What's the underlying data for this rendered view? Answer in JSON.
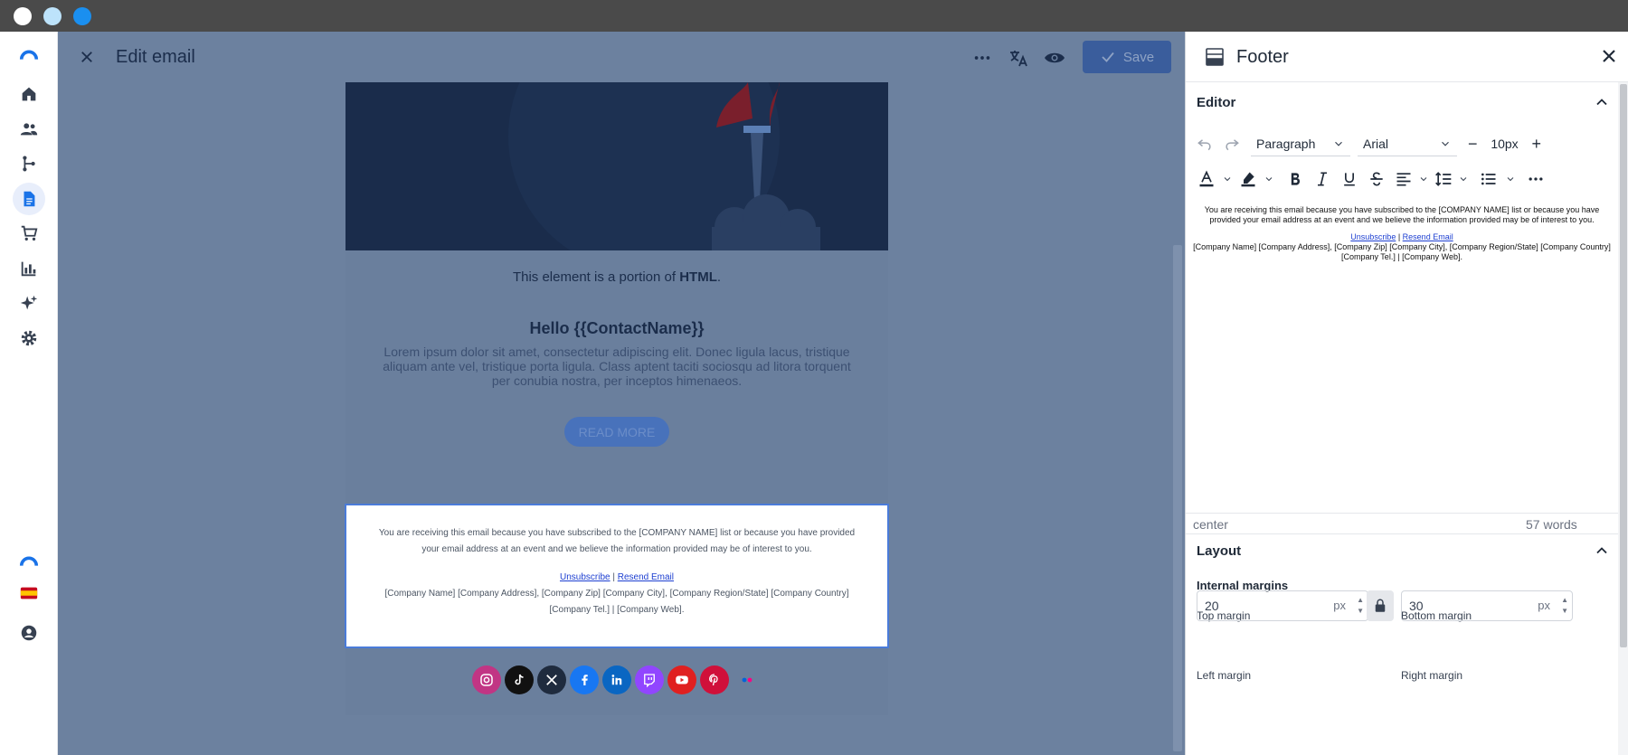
{
  "window": {
    "traffic_lights": [
      "close",
      "minimize",
      "maximize"
    ]
  },
  "rail": {
    "items": [
      "logo-icon",
      "home-icon",
      "contacts-icon",
      "flows-icon",
      "documents-icon",
      "cart-icon",
      "reports-icon",
      "ai-sparkle-icon",
      "settings-icon",
      "brand-icon",
      "language-flag-es-icon",
      "account-icon"
    ]
  },
  "header": {
    "title": "Edit email",
    "save_label": "Save"
  },
  "email": {
    "html_note_pre": "This element is a portion of ",
    "html_note_bold": "HTML",
    "html_note_post": ".",
    "hello": "Hello {{ContactName}}",
    "lorem": "Lorem ipsum dolor sit amet, consectetur adipiscing elit. Donec ligula lacus, tristique aliquam ante vel, tristique porta ligula. Class aptent taciti sociosqu ad litora torquent per conubia nostra, per inceptos himenaeos.",
    "read_more": "READ MORE",
    "footer": {
      "line1": "You are receiving this email because you have subscribed to the [COMPANY NAME] list or because you have provided your email address at an event and we believe the information provided may be of interest to you.",
      "unsubscribe": "Unsubscribe",
      "sep": " | ",
      "resend": "Resend Email",
      "address": "[Company Name] [Company Address], [Company Zip] [Company City], [Company Region/State] [Company Country]",
      "contact": "[Company Tel.] | [Company Web]."
    },
    "social": [
      {
        "name": "instagram",
        "color": "#c13584"
      },
      {
        "name": "tiktok",
        "color": "#111111"
      },
      {
        "name": "x",
        "color": "#1f2b3e"
      },
      {
        "name": "facebook",
        "color": "#1877f2"
      },
      {
        "name": "linkedin",
        "color": "#0a66c2"
      },
      {
        "name": "twitch",
        "color": "#9146ff"
      },
      {
        "name": "youtube",
        "color": "#e02020"
      },
      {
        "name": "pinterest",
        "color": "#d0103a"
      },
      {
        "name": "flickr",
        "color": "transparent"
      }
    ]
  },
  "panel": {
    "title": "Footer",
    "editor": {
      "section_title": "Editor",
      "block_format": "Paragraph",
      "font": "Arial",
      "font_size": "10px",
      "alignment_status": "center",
      "word_count": "57 words"
    },
    "layout": {
      "section_title": "Layout",
      "internal_margins": "Internal margins",
      "top_margin_label": "Top margin",
      "top_margin": "20",
      "bottom_margin_label": "Bottom margin",
      "bottom_margin": "30",
      "left_margin_label": "Left margin",
      "right_margin_label": "Right margin",
      "unit": "px"
    }
  },
  "colors": {
    "accent": "#1a73e8",
    "save_disabled": "#3a5d9c",
    "overlay": "#6c819f"
  }
}
